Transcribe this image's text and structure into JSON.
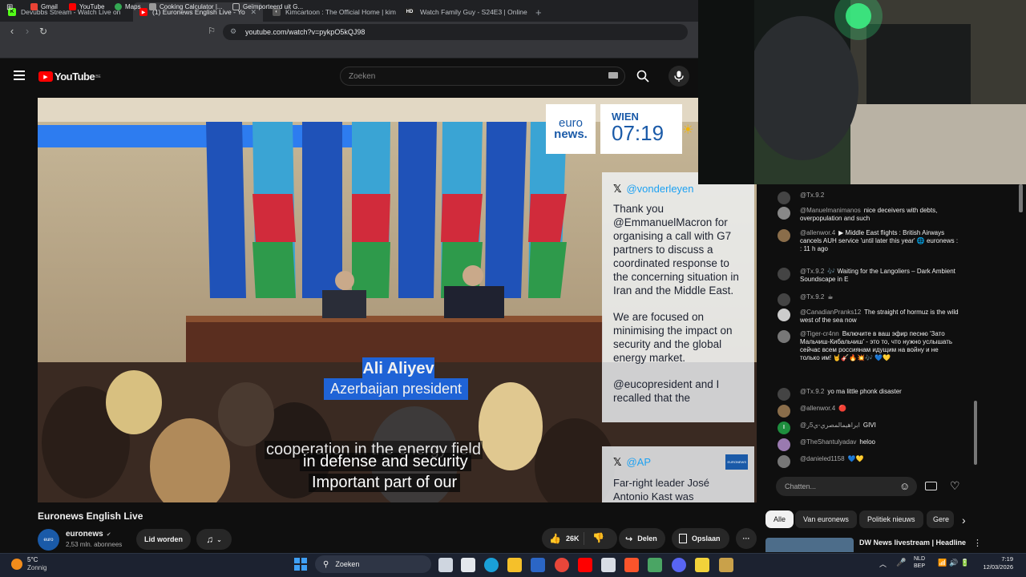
{
  "browser": {
    "tabs": [
      {
        "title": "Devubbs Stream - Watch Live on",
        "color": "#53fc18",
        "glyph": "K"
      },
      {
        "title": "(1) Euronews English Live - Yo",
        "color": "#ff0000",
        "glyph": "▶"
      },
      {
        "title": "Kimcartoon : The Official Home | kim",
        "color": "#555555",
        "glyph": "◐"
      },
      {
        "title": "Watch Family Guy - S24E3 | Online H",
        "color": "#222222",
        "glyph": "HD"
      }
    ],
    "new_tab": "+",
    "url": "youtube.com/watch?v=pykpO5kQJ98",
    "bookmarks": [
      {
        "label": "Gmail",
        "color": "#ea4335"
      },
      {
        "label": "YouTube",
        "color": "#ff0000"
      },
      {
        "label": "Maps",
        "color": "#34a853"
      },
      {
        "label": "Cooking Calculator |...",
        "color": "#999999"
      },
      {
        "label": "Geïmporteerd uit G...",
        "color": "#bbbbbb"
      }
    ]
  },
  "youtube": {
    "logo": "YouTube",
    "region": "BE",
    "search_placeholder": "Zoeken"
  },
  "video": {
    "logo_line1": "euro",
    "logo_line2": "news.",
    "city": "WIEN",
    "time": "07:19",
    "lower_third_name": "Ali Aliyev",
    "lower_third_role": "Azerbaijan president",
    "caption1": "cooperation in the energy field",
    "caption2": "in defense and security",
    "caption3": "Important part of our",
    "tweet1_handle": "@vonderleyen",
    "tweet1_p1": "Thank you @EmmanuelMacron for organising a call with G7 partners to discuss a coordinated response to the concerning situation in Iran and the Middle East.",
    "tweet1_p2": "We are focused on minimising the impact on security and the global energy market.",
    "tweet1_p3": "@eucopresident and I recalled that the",
    "tweet2_handle": "@AP",
    "tweet2_text": "Far-right leader José Antonio Kast was",
    "tweet2_badge": "EURONEWS"
  },
  "video_info": {
    "title": "Euronews English Live",
    "channel": "euronews",
    "subscribers": "2,53 mln. abonnees",
    "join_label": "Lid worden",
    "likes": "26K",
    "share_label": "Delen",
    "save_label": "Opslaan",
    "more": "···"
  },
  "chat": {
    "messages": [
      {
        "user": "@Tx.9.2",
        "text": "",
        "color": "#444444"
      },
      {
        "user": "@Manuelmanimanos",
        "text": "nice deceivers with debts, overpopulation and such",
        "color": "#888888"
      },
      {
        "user": "@allenwor.4",
        "text": "▶ Middle East flights : British Airways cancels AUH service 'until later this year' 🌐 euronews : : 11 h ago",
        "color": "#8a6d4a"
      },
      {
        "user": "@Tx.9.2",
        "text": "🎶 Waiting for the Langoliers – Dark Ambient Soundscape in E",
        "color": "#444444"
      },
      {
        "user": "@Tx.9.2",
        "text": "☕",
        "color": "#444444"
      },
      {
        "user": "@CanadianPranks12",
        "text": "The straight of hormuz is the wild west of the sea now",
        "color": "#cccccc"
      },
      {
        "user": "@Tiger-cr4nn",
        "text": "Включите в ваш эфир песню 'Зато Мальчиш-Кибальчиш' - это то, что нужно услышать сейчас всем россиянам идущим на войну и не только им! 🤘🎸🔥💥🎶 💙💛",
        "color": "#777777"
      },
      {
        "user": "@Tx.9.2",
        "text": "yo ma little phonk disaster",
        "color": "#444444"
      },
      {
        "user": "@allenwor.4",
        "text": "🔴",
        "color": "#8a6d4a"
      },
      {
        "user": "@ابراهيمالمصري-ي5ر",
        "text": "GIVI",
        "color": "#1e8e3e"
      },
      {
        "user": "@TheShantulyadav",
        "text": "heloo",
        "color": "#9a7ab0"
      },
      {
        "user": "@danieled1158",
        "text": "💙💛",
        "color": "#777777"
      }
    ],
    "input_placeholder": "Chatten..."
  },
  "chips": [
    "Alle",
    "Van euronews",
    "Politiek nieuws",
    "Gere"
  ],
  "recommended": {
    "title": "DW News livestream | Headline"
  },
  "taskbar": {
    "temp": "5°C",
    "weather": "Zonnig",
    "search_label": "Zoeken",
    "lang1": "NLD",
    "lang2": "BEP",
    "clock": "7:19",
    "date": "12/03/2026"
  }
}
